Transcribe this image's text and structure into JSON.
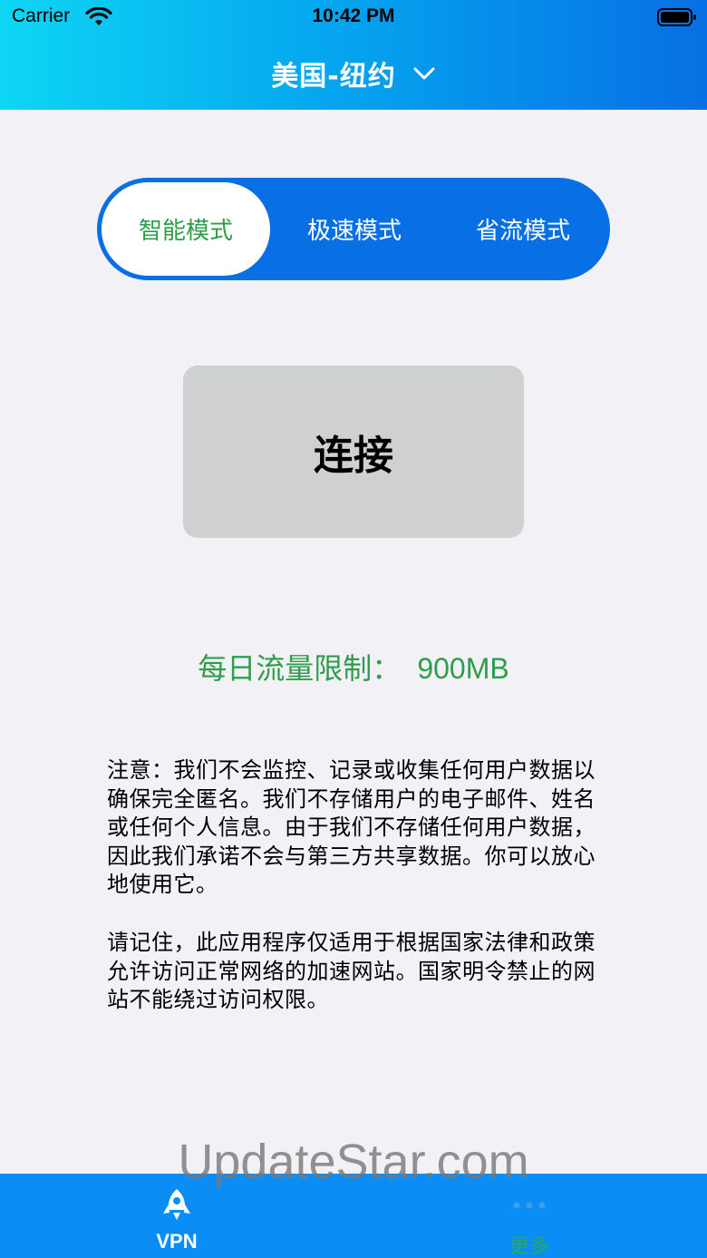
{
  "status_bar": {
    "carrier": "Carrier",
    "time": "10:42 PM"
  },
  "header": {
    "title": "美国-纽约",
    "dropdown_icon": "chevron-down-icon"
  },
  "modes": {
    "items": [
      {
        "label": "智能模式",
        "active": true
      },
      {
        "label": "极速模式",
        "active": false
      },
      {
        "label": "省流模式",
        "active": false
      }
    ]
  },
  "connect": {
    "label": "连接"
  },
  "limit": {
    "label": "每日流量限制：",
    "value": "900MB"
  },
  "notices": {
    "p1": "注意：我们不会监控、记录或收集任何用户数据以确保完全匿名。我们不存储用户的电子邮件、姓名或任何个人信息。由于我们不存储任何用户数据，因此我们承诺不会与第三方共享数据。你可以放心地使用它。",
    "p2": "请记住，此应用程序仅适用于根据国家法律和政策允许访问正常网络的加速网站。国家明令禁止的网站不能绕过访问权限。"
  },
  "watermark": "UpdateStar.com",
  "tabbar": {
    "tabs": [
      {
        "label": "VPN",
        "icon": "rocket-icon"
      },
      {
        "label": "更多",
        "icon": "more-dots-icon"
      }
    ]
  },
  "colors": {
    "header_start": "#0ed6f4",
    "header_end": "#0770e4",
    "switch_bg": "#0870e4",
    "accent_green": "#2e9e4a",
    "tabbar_bg": "#0a8ef6",
    "connect_bg": "#cfd0d0"
  }
}
